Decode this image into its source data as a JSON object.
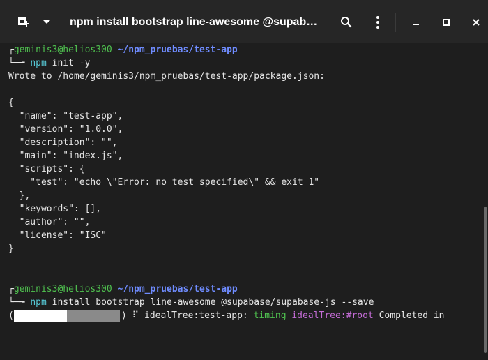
{
  "titlebar": {
    "title": "npm install bootstrap line-awesome @supabase...",
    "icons": {
      "new_tab": "new-tab-icon",
      "tab_menu": "chevron-down-icon",
      "search": "search-icon",
      "menu": "kebab-icon",
      "minimize": "minimize-icon",
      "maximize": "maximize-icon",
      "close": "close-icon"
    }
  },
  "colors": {
    "prompt_user": "#4fc14f",
    "prompt_path": "#6f8cff",
    "prompt_cmd": "#56c7d4",
    "timing_word": "#4fc14f",
    "idealtree_word": "#c46cd6"
  },
  "terminal": {
    "prompt1": {
      "corner": "┌",
      "user": "geminis3@helios300",
      "path": "~/npm_pruebas/test-app",
      "arrow": "└─╼",
      "cmd_name": "npm",
      "cmd_args": "init -y"
    },
    "output": [
      "Wrote to /home/geminis3/npm_pruebas/test-app/package.json:",
      "",
      "{",
      "  \"name\": \"test-app\",",
      "  \"version\": \"1.0.0\",",
      "  \"description\": \"\",",
      "  \"main\": \"index.js\",",
      "  \"scripts\": {",
      "    \"test\": \"echo \\\"Error: no test specified\\\" && exit 1\"",
      "  },",
      "  \"keywords\": [],",
      "  \"author\": \"\",",
      "  \"license\": \"ISC\"",
      "}"
    ],
    "prompt2": {
      "corner": "┌",
      "user": "geminis3@helios300",
      "path": "~/npm_pruebas/test-app",
      "arrow": "└─╼",
      "cmd_name": "npm",
      "cmd_args": "install bootstrap line-awesome @supabase/supabase-js --save"
    },
    "progress": {
      "open": "(",
      "close": ")",
      "spinner": "⠏",
      "stage": "idealTree:test-app:",
      "timing": "timing",
      "tree": "idealTree:#root",
      "status": "Completed in",
      "fraction": 0.5
    }
  }
}
